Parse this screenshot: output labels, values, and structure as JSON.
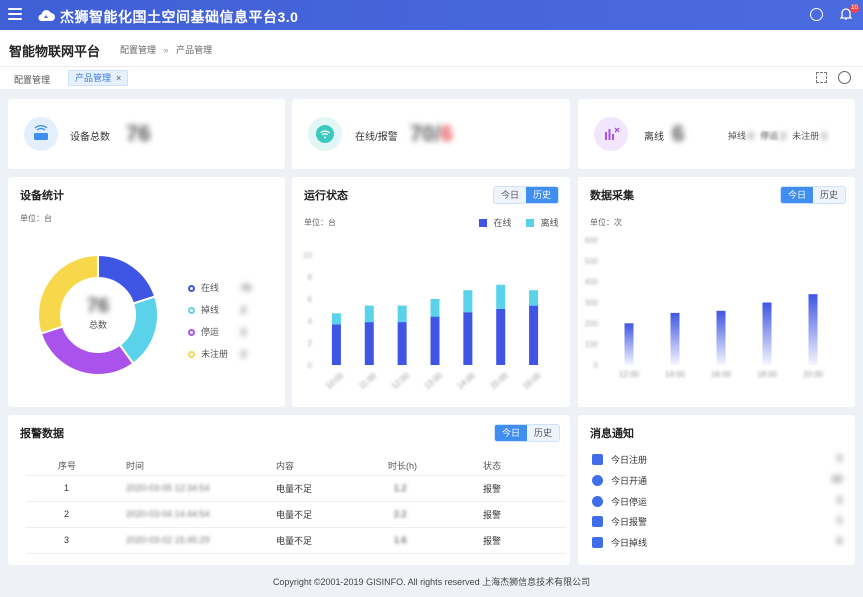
{
  "app": {
    "title": "杰狮智能化国土空间基础信息平台3.0",
    "badge": "10"
  },
  "subheader": {
    "title": "智能物联网平台",
    "crumb1": "配置管理",
    "sep": "»",
    "crumb2": "产品管理"
  },
  "tabs": {
    "first": "配置管理",
    "active": "产品管理",
    "close": "×"
  },
  "stats": {
    "total": {
      "label": "设备总数",
      "value": "76"
    },
    "online": {
      "label": "在线/报警",
      "value": "70",
      "slash": "/",
      "alarm": "6"
    },
    "offline": {
      "label": "离线",
      "value": "6",
      "drop": "掉线",
      "drop_val": "0",
      "stop": "停运",
      "stop_val": "2",
      "unreg": "未注册",
      "unreg_val": "2"
    }
  },
  "device_stats": {
    "title": "设备统计",
    "unit": "单位：台",
    "center_value": "76",
    "center_label": "总数",
    "legend": [
      {
        "label": "在线",
        "value": "70",
        "color": "#3f55e3"
      },
      {
        "label": "掉线",
        "value": "2",
        "color": "#5ad3ea"
      },
      {
        "label": "停运",
        "value": "2",
        "color": "#a953ec"
      },
      {
        "label": "未注册",
        "value": "2",
        "color": "#f7d84a"
      }
    ],
    "chart_data": {
      "type": "pie",
      "labels": [
        "在线",
        "掉线",
        "停运",
        "未注册"
      ],
      "values": [
        20,
        20,
        30,
        30
      ],
      "colors": [
        "#3f55e3",
        "#5ad3ea",
        "#a953ec",
        "#f7d84a"
      ]
    }
  },
  "run_status": {
    "title": "运行状态",
    "today": "今日",
    "history": "历史",
    "unit": "单位：台",
    "legend_online": "在线",
    "legend_offline": "离线",
    "yticks": [
      "10",
      "8",
      "6",
      "4",
      "2",
      "0"
    ],
    "chart_data": {
      "type": "bar",
      "categories": [
        "10:00",
        "11:00",
        "12:00",
        "13:00",
        "14:00",
        "15:00",
        "16:00"
      ],
      "series": [
        {
          "name": "在线",
          "values": [
            3.7,
            3.9,
            3.9,
            4.4,
            4.8,
            5.1,
            5.4
          ]
        },
        {
          "name": "离线",
          "values": [
            1.0,
            1.5,
            1.5,
            1.6,
            2.0,
            2.2,
            1.4
          ]
        }
      ],
      "ylim": [
        0,
        10
      ]
    }
  },
  "data_collect": {
    "title": "数据采集",
    "today": "今日",
    "history": "历史",
    "unit": "单位：次",
    "yticks": [
      "600",
      "500",
      "400",
      "300",
      "200",
      "100",
      "0"
    ],
    "chart_data": {
      "type": "bar",
      "categories": [
        "12:00",
        "14:00",
        "16:00",
        "18:00",
        "20:00"
      ],
      "values": [
        200,
        250,
        260,
        300,
        340
      ],
      "ylim": [
        0,
        600
      ]
    }
  },
  "alarm": {
    "title": "报警数据",
    "today": "今日",
    "history": "历史",
    "headers": [
      "序号",
      "时间",
      "内容",
      "时长(h)",
      "状态"
    ],
    "rows": [
      [
        "1",
        "2020-03-05 12:34:54",
        "电量不足",
        "1.2",
        "报警"
      ],
      [
        "2",
        "2020-03-04 14:44:54",
        "电量不足",
        "2.2",
        "报警"
      ],
      [
        "3",
        "2020-03-02 15:45:29",
        "电量不足",
        "1.6",
        "报警"
      ]
    ]
  },
  "notices": {
    "title": "消息通知",
    "items": [
      {
        "label": "今日注册",
        "value": "2",
        "icon": "user-add-icon"
      },
      {
        "label": "今日开通",
        "value": "23",
        "icon": "check-circle-icon"
      },
      {
        "label": "今日停运",
        "value": "2",
        "icon": "pause-circle-icon"
      },
      {
        "label": "今日报警",
        "value": "1",
        "icon": "alarm-bell-icon"
      },
      {
        "label": "今日掉线",
        "value": "0",
        "icon": "monitor-x-icon"
      }
    ]
  },
  "footer": "Copyright ©2001-2019 GISINFO. All rights reserved 上海杰狮信息技术有限公司"
}
